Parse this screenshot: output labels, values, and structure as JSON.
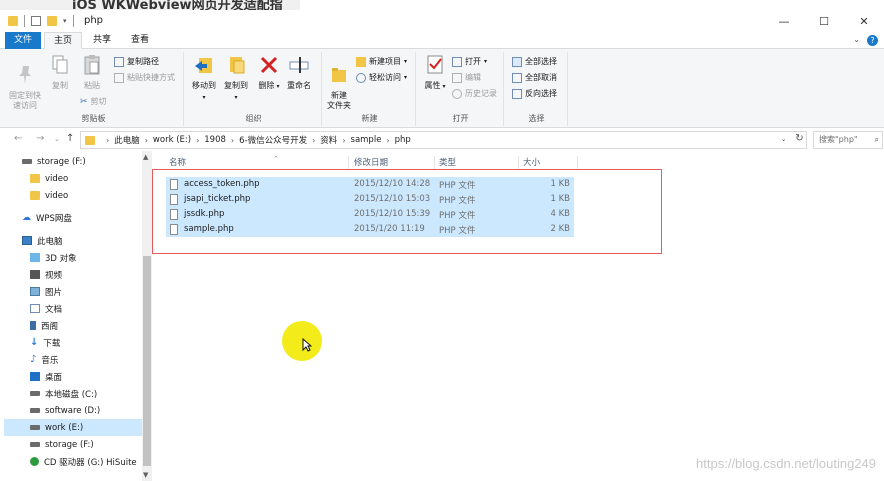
{
  "overlay": {
    "title": "iOS WKWebview网页开发适配指"
  },
  "window": {
    "title": "php",
    "minimize": "—",
    "maximize": "☐",
    "close": "✕"
  },
  "tabs": [
    {
      "label": "文件"
    },
    {
      "label": "主页"
    },
    {
      "label": "共享"
    },
    {
      "label": "查看"
    }
  ],
  "ribbon": {
    "clipboard": {
      "label": "剪贴板",
      "pin": "固定到快\n速访问",
      "copy": "复制",
      "paste": "粘贴",
      "copy_path": "复制路径",
      "paste_shortcut": "粘贴快捷方式",
      "cut": "剪切"
    },
    "organize": {
      "label": "组织",
      "move_to": "移动到",
      "copy_to": "复制到",
      "delete": "删除",
      "rename": "重命名"
    },
    "new": {
      "label": "新建",
      "new_folder": "新建\n文件夹",
      "new_item": "新建项目",
      "easy_access": "轻松访问"
    },
    "open": {
      "label": "打开",
      "properties": "属性",
      "open": "打开",
      "edit": "编辑",
      "history": "历史记录"
    },
    "select": {
      "label": "选择",
      "select_all": "全部选择",
      "select_none": "全部取消",
      "invert": "反向选择"
    }
  },
  "address": {
    "crumbs": [
      "此电脑",
      "work (E:)",
      "1908",
      "6-微信公众号开发",
      "资料",
      "sample",
      "php"
    ],
    "search_placeholder": "搜索\"php\""
  },
  "nav": [
    {
      "label": "storage (F:)",
      "icon": "drive"
    },
    {
      "label": "video",
      "icon": "folder"
    },
    {
      "label": "video",
      "icon": "folder"
    },
    {
      "label": "WPS网盘",
      "icon": "cloud"
    },
    {
      "label": "此电脑",
      "icon": "pc"
    },
    {
      "label": "3D 对象",
      "icon": "3d"
    },
    {
      "label": "视频",
      "icon": "video"
    },
    {
      "label": "图片",
      "icon": "pictures"
    },
    {
      "label": "文档",
      "icon": "documents"
    },
    {
      "label": "西阁",
      "icon": "phone"
    },
    {
      "label": "下载",
      "icon": "download"
    },
    {
      "label": "音乐",
      "icon": "music"
    },
    {
      "label": "桌面",
      "icon": "desktop"
    },
    {
      "label": "本地磁盘 (C:)",
      "icon": "drive"
    },
    {
      "label": "software (D:)",
      "icon": "drive"
    },
    {
      "label": "work (E:)",
      "icon": "drive",
      "selected": true
    },
    {
      "label": "storage (F:)",
      "icon": "drive"
    },
    {
      "label": "CD 驱动器 (G:) HiSuite",
      "icon": "cd"
    }
  ],
  "columns": {
    "name": "名称",
    "modified": "修改日期",
    "type": "类型",
    "size": "大小"
  },
  "files": [
    {
      "name": "access_token.php",
      "modified": "2015/12/10 14:28",
      "type": "PHP 文件",
      "size": "1 KB"
    },
    {
      "name": "jsapi_ticket.php",
      "modified": "2015/12/10 15:03",
      "type": "PHP 文件",
      "size": "1 KB"
    },
    {
      "name": "jssdk.php",
      "modified": "2015/12/10 15:39",
      "type": "PHP 文件",
      "size": "4 KB"
    },
    {
      "name": "sample.php",
      "modified": "2015/1/20 11:19",
      "type": "PHP 文件",
      "size": "2 KB"
    }
  ],
  "watermark": "https://blog.csdn.net/louting249",
  "colors": {
    "accent": "#1979ca",
    "selection": "#cce8ff",
    "highlight_box": "#e55b5b",
    "cursor_halo": "#f3eb1a"
  }
}
